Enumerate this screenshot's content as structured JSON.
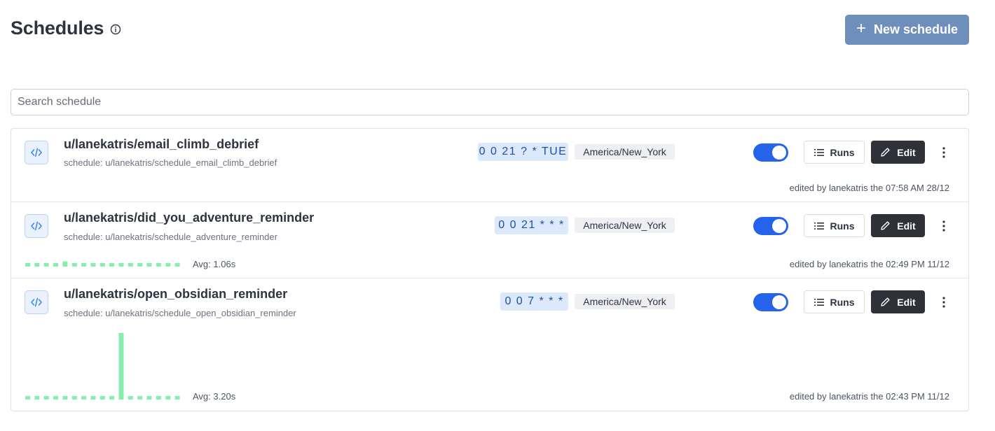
{
  "page": {
    "title": "Schedules",
    "new_button_label": "New schedule"
  },
  "search": {
    "placeholder": "Search schedule",
    "value": ""
  },
  "icons": {
    "info": "info-circle-icon",
    "plus": "plus-icon",
    "code": "code-icon",
    "list": "list-icon",
    "pencil": "pencil-icon",
    "more": "more-vertical-icon"
  },
  "colors": {
    "accent_button": "#6e8fbb",
    "toggle_on": "#2563eb",
    "cron_bg": "#dbe9fb",
    "cron_text": "#1f4ea8",
    "edit_bg": "#2e3138",
    "spark": "#86efac"
  },
  "schedules": [
    {
      "path": "u/lanekatris/email_climb_debrief",
      "schedule_label": "schedule: u/lanekatris/schedule_email_climb_debrief",
      "cron": "0 0 21 ? * TUE",
      "timezone": "America/New_York",
      "enabled": true,
      "runs_label": "Runs",
      "edit_label": "Edit",
      "edited": "edited by lanekatris the 07:58 AM 28/12",
      "avg": "",
      "durations": []
    },
    {
      "path": "u/lanekatris/did_you_adventure_reminder",
      "schedule_label": "schedule: u/lanekatris/schedule_adventure_reminder",
      "cron": "0 0 21 * * *",
      "timezone": "America/New_York",
      "enabled": true,
      "runs_label": "Runs",
      "edit_label": "Edit",
      "edited": "edited by lanekatris the 02:49 PM 11/12",
      "avg": "Avg: 1.06s",
      "durations": [
        1.0,
        1.0,
        1.0,
        1.0,
        1.5,
        1.0,
        1.0,
        1.0,
        1.0,
        1.0,
        1.0,
        1.0,
        1.0,
        1.0,
        1.0,
        1.0,
        1.0
      ]
    },
    {
      "path": "u/lanekatris/open_obsidian_reminder",
      "schedule_label": "schedule: u/lanekatris/schedule_open_obsidian_reminder",
      "cron": "0 0 7 * * *",
      "timezone": "America/New_York",
      "enabled": true,
      "runs_label": "Runs",
      "edit_label": "Edit",
      "edited": "edited by lanekatris the 02:43 PM 11/12",
      "avg": "Avg: 3.20s",
      "durations": [
        1.0,
        1.0,
        1.0,
        1.0,
        1.0,
        1.0,
        1.0,
        1.0,
        1.0,
        1.0,
        19.0,
        1.0,
        1.0,
        1.0,
        1.0,
        1.0,
        1.0
      ]
    }
  ]
}
